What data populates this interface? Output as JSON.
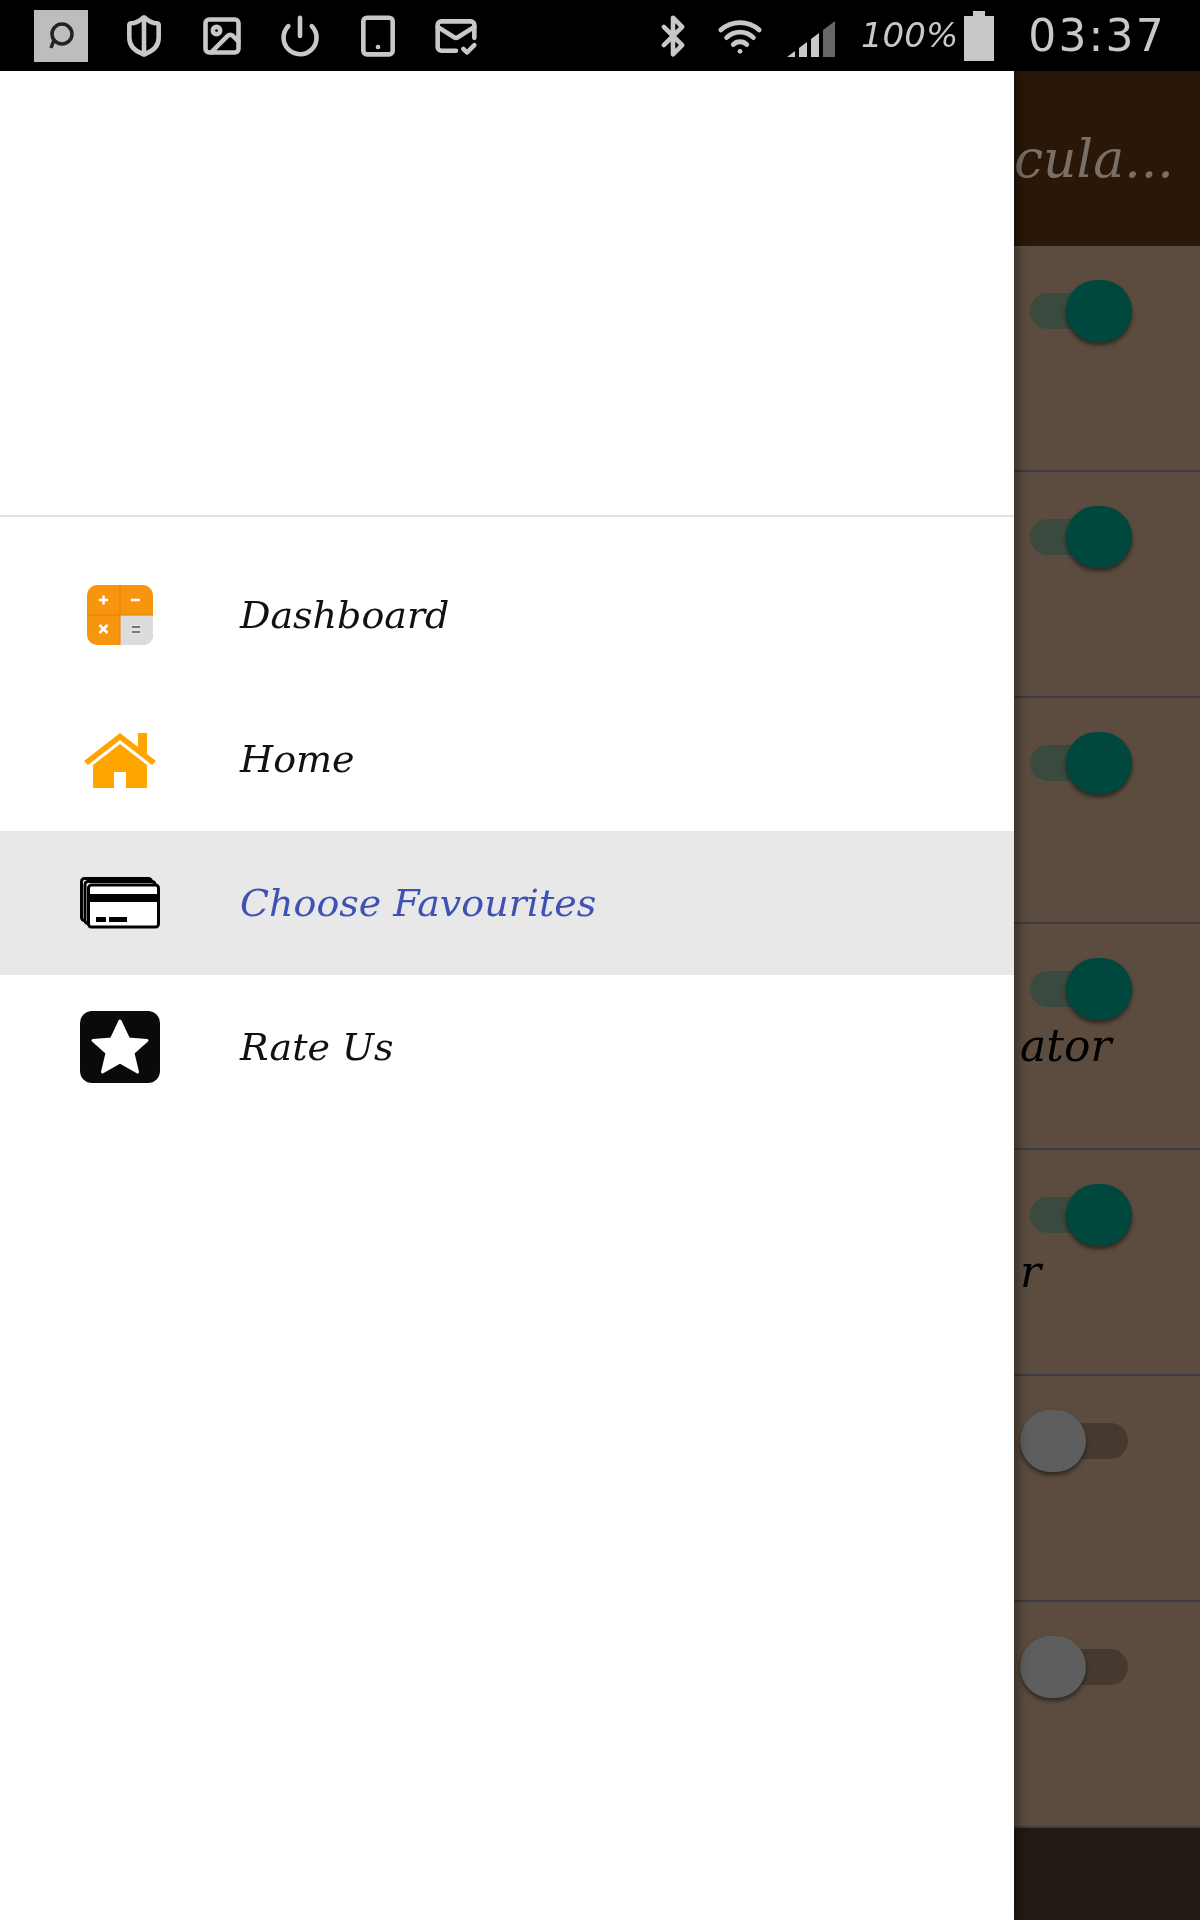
{
  "status_bar": {
    "battery": "100%",
    "time": "03:37"
  },
  "drawer": {
    "items": [
      {
        "kind": "calculator",
        "label": "Dashboard",
        "selected": false
      },
      {
        "kind": "home",
        "label": "Home",
        "selected": false
      },
      {
        "kind": "cards",
        "label": "Choose Favourites",
        "selected": true
      },
      {
        "kind": "star",
        "label": "Rate Us",
        "selected": false
      }
    ]
  },
  "background_app": {
    "title": "cula...",
    "rows": [
      {
        "on": true
      },
      {
        "on": true
      },
      {
        "on": true
      },
      {
        "on": true,
        "label": "ator"
      },
      {
        "on": true,
        "label": "r"
      },
      {
        "on": false
      },
      {
        "on": false
      }
    ]
  }
}
